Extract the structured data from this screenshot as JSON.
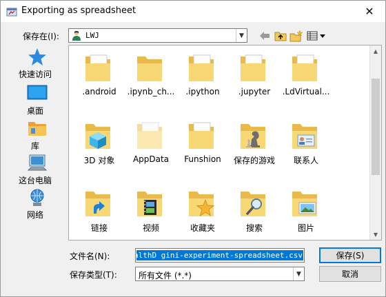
{
  "window": {
    "title": "Exporting as spreadsheet",
    "close_symbol": "✕"
  },
  "lookin": {
    "label": "保存在(I):",
    "value": "LWJ",
    "icon": "user-folder-icon"
  },
  "toolbar": [
    {
      "name": "back-button",
      "icon": "back-arrow-icon"
    },
    {
      "name": "up-one-level-button",
      "icon": "up-folder-icon"
    },
    {
      "name": "new-folder-button",
      "icon": "new-folder-icon"
    },
    {
      "name": "view-menu-button",
      "icon": "view-menu-icon"
    }
  ],
  "places": [
    {
      "label": "快速访问",
      "icon": "star-icon"
    },
    {
      "label": "桌面",
      "icon": "desktop-icon"
    },
    {
      "label": "库",
      "icon": "library-icon"
    },
    {
      "label": "这台电脑",
      "icon": "computer-icon"
    },
    {
      "label": "网络",
      "icon": "network-icon"
    }
  ],
  "items": [
    {
      "label": ".android",
      "icon": "folder-doc-icon"
    },
    {
      "label": ".ipynb_ch...",
      "icon": "folder-icon"
    },
    {
      "label": ".ipython",
      "icon": "folder-doc-icon"
    },
    {
      "label": ".jupyter",
      "icon": "folder-doc-icon"
    },
    {
      "label": ".LdVirtual...",
      "icon": "folder-doc-icon"
    },
    {
      "label": "3D 对象",
      "icon": "folder-3d-icon"
    },
    {
      "label": "AppData",
      "icon": "folder-light-icon"
    },
    {
      "label": "Funshion",
      "icon": "folder-doc-icon"
    },
    {
      "label": "保存的游戏",
      "icon": "folder-chess-icon"
    },
    {
      "label": "联系人",
      "icon": "folder-contact-icon"
    },
    {
      "label": "链接",
      "icon": "folder-link-icon"
    },
    {
      "label": "视频",
      "icon": "folder-video-icon"
    },
    {
      "label": "收藏夹",
      "icon": "folder-star-icon"
    },
    {
      "label": "搜索",
      "icon": "folder-search-icon"
    },
    {
      "label": "图片",
      "icon": "folder-picture-icon"
    }
  ],
  "filename": {
    "label": "文件名(N):",
    "value": "ealthD gini-experiment-spreadsheet.csv"
  },
  "filetype": {
    "label": "保存类型(T):",
    "value": "所有文件 (*.*)"
  },
  "buttons": {
    "save": "保存(S)",
    "cancel": "取消"
  },
  "colors": {
    "selection": "#0078d7",
    "folder": "#f8d775",
    "accent": "#0078d7"
  }
}
